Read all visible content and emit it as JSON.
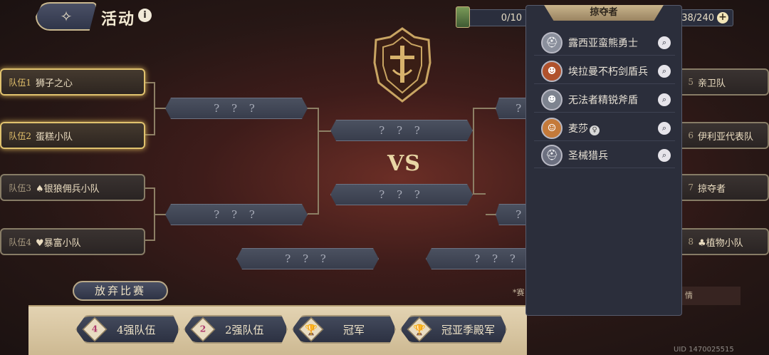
{
  "header": {
    "title": "活动",
    "info_symbol": "i",
    "back_symbol": "✧"
  },
  "resources": [
    {
      "value": "0/10",
      "icon": "card-icon"
    },
    {
      "value": "38/240",
      "icon": "energy-icon"
    }
  ],
  "plus_symbol": "+",
  "left_teams": [
    {
      "tag": "队伍1",
      "name": "狮子之心",
      "active": true
    },
    {
      "tag": "队伍2",
      "name": "蛋糕小队",
      "active": true
    },
    {
      "tag": "队伍3",
      "name": "♠银狼佣兵小队",
      "active": false
    },
    {
      "tag": "队伍4",
      "name": "♥暴富小队",
      "active": false
    }
  ],
  "right_teams": [
    {
      "tag": "5",
      "name": "亲卫队"
    },
    {
      "tag": "6",
      "name": "伊利亚代表队"
    },
    {
      "tag": "7",
      "name": "掠夺者"
    },
    {
      "tag": "8",
      "name": "♣植物小队"
    }
  ],
  "unknown_label": "? ? ?",
  "vs_label": "VS",
  "quit_label": "放弃比赛",
  "stages": [
    {
      "badge": "4",
      "label": "4强队伍"
    },
    {
      "badge": "2",
      "label": "2强队伍"
    },
    {
      "badge": "🏆",
      "label": "冠军"
    },
    {
      "badge": "🏆",
      "label": "冠亚季殿军"
    }
  ],
  "notice_fragment": "*赛",
  "notice_fragment2": "情",
  "uid": "UID 1470025515",
  "popup": {
    "title": "掠夺者",
    "members": [
      {
        "name": "露西亚蛮熊勇士",
        "avatar_color": "#8a8f9c",
        "badge": ""
      },
      {
        "name": "埃拉曼不朽剑盾兵",
        "avatar_color": "#b0522c",
        "badge": ""
      },
      {
        "name": "无法者精锐斧盾",
        "avatar_color": "#7d838f",
        "badge": ""
      },
      {
        "name": "麦莎",
        "avatar_color": "#c47a3a",
        "badge": "♀"
      },
      {
        "name": "圣械猎兵",
        "avatar_color": "#6c7080",
        "badge": ""
      }
    ],
    "search_symbol": "⌕"
  }
}
